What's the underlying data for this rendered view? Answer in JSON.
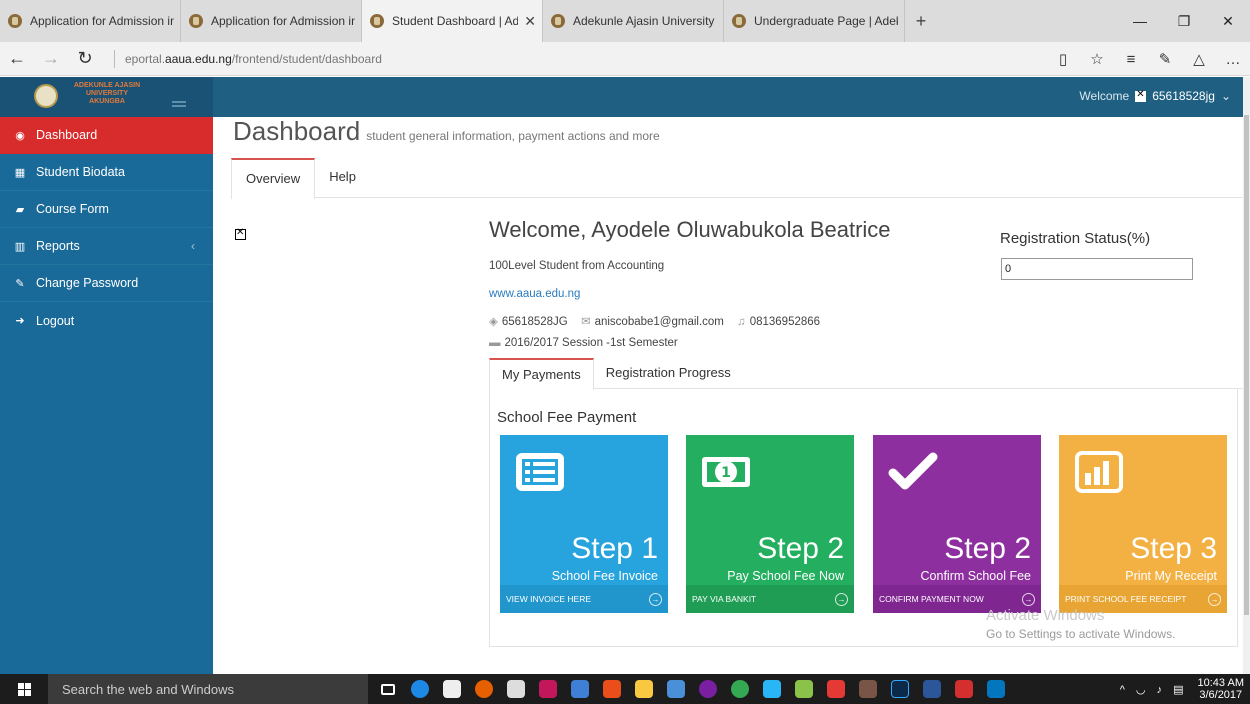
{
  "browser": {
    "tabs": [
      {
        "title": "Application for Admission in",
        "active": false
      },
      {
        "title": "Application for Admission in",
        "active": false
      },
      {
        "title": "Student Dashboard | Ad",
        "active": true
      },
      {
        "title": "Adekunle Ajasin University A",
        "active": false
      },
      {
        "title": "Undergraduate Page | Adeku",
        "active": false
      }
    ],
    "url_prefix": "eportal.",
    "url_domain": "aaua.edu.ng",
    "url_path": "/frontend/student/dashboard"
  },
  "header": {
    "logo_lines": [
      "ADEKUNLE AJASIN",
      "UNIVERSITY",
      "AKUNGBA"
    ],
    "welcome_label": "Welcome",
    "username": "65618528jg"
  },
  "sidebar": {
    "items": [
      {
        "label": "Dashboard",
        "icon": "tachometer-icon"
      },
      {
        "label": "Student Biodata",
        "icon": "table-icon"
      },
      {
        "label": "Course Form",
        "icon": "book-icon"
      },
      {
        "label": "Reports",
        "icon": "bar-chart-icon"
      },
      {
        "label": "Change Password",
        "icon": "edit-icon"
      },
      {
        "label": "Logout",
        "icon": "sign-out-icon"
      }
    ]
  },
  "page": {
    "title": "Dashboard",
    "subtitle": "student general information, payment actions and more",
    "tabs": [
      "Overview",
      "Help"
    ]
  },
  "profile": {
    "welcome": "Welcome, Ayodele Oluwabukola Beatrice",
    "level": "100Level Student from Accounting",
    "website": "www.aaua.edu.ng",
    "matric": "65618528JG",
    "email": "aniscobabe1@gmail.com",
    "phone": "08136952866",
    "session": "2016/2017 Session -1st Semester",
    "reg_status_label": "Registration Status(%)",
    "reg_status_value": "0"
  },
  "payments": {
    "tabs": [
      "My Payments",
      "Registration Progress"
    ],
    "panel_title": "School Fee Payment",
    "tiles": [
      {
        "step": "Step 1",
        "desc": "School Fee Invoice",
        "action": "VIEW INVOICE HERE",
        "color": "#27a4dd"
      },
      {
        "step": "Step 2",
        "desc": "Pay School Fee Now",
        "action": "PAY VIA BANKIT",
        "color": "#24ae5f"
      },
      {
        "step": "Step 2",
        "desc": "Confirm School Fee",
        "action": "CONFIRM PAYMENT NOW",
        "color": "#8e2f9f"
      },
      {
        "step": "Step 3",
        "desc": "Print My Receipt",
        "action": "PRINT SCHOOL FEE RECEIPT",
        "color": "#f4b143"
      }
    ]
  },
  "watermark": {
    "line1": "Activate Windows",
    "line2": "Go to Settings to activate Windows."
  },
  "taskbar": {
    "search_placeholder": "Search the web and Windows",
    "time": "10:43 AM",
    "date": "3/6/2017"
  }
}
